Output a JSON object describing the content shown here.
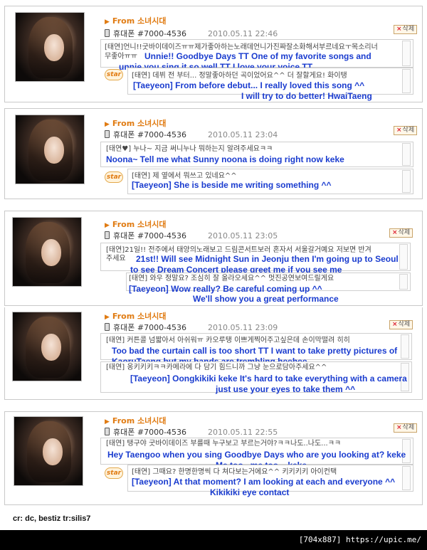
{
  "posts": [
    {
      "from": "From 소녀시대",
      "phone": "휴대폰 #7000-4536",
      "date": "2010.05.11 22:46",
      "delete": "삭제",
      "comment_kr": [
        "[태연]언니!!굿바이데이즈ㅠㅠ제가좋아하는노래데언니가진짜잘소화해서부르네요ㅜ목소리너",
        "무좋아ㅠㅠ"
      ],
      "comment_en": [
        "Unnie!! Goodbye Days TT One of my favorite songs and",
        "unnie you sing it so well TT I love your voice TT"
      ],
      "star": "star",
      "reply_kr": [
        "[태연] 데뷔 전 부터... 정말좋아하던 곡이었어요^^ 더 잘할게요! 화이탱"
      ],
      "reply_en": [
        "[Taeyeon] From before debut... I really loved this song ^^",
        "I will try to do better! HwaiTaeng"
      ]
    },
    {
      "from": "From 소녀시대",
      "phone": "휴대폰 #7000-4536",
      "date": "2010.05.11 23:04",
      "delete": "삭제",
      "comment_kr": [
        "[태연♥] 누나~ 지금 써니누나 뭐하는지 알려주세요ㅋㅋ"
      ],
      "comment_en": [
        "Noona~ Tell me what Sunny noona is doing right now keke"
      ],
      "star": "star",
      "reply_kr": [
        "[태연] 제 옆에서 뭐쓰고 있네요^^"
      ],
      "reply_en": [
        "[Taeyeon] She is beside me writing something ^^"
      ]
    },
    {
      "from": "From 소녀시대",
      "phone": "휴대폰 #7000-4536",
      "date": "2010.05.11 23:05",
      "delete": "삭제",
      "comment_kr": [
        "[태연]21일!! 전주에서 태양의노래보고 드림콘서트보러 혼자서 서울갈거예요 저보면 반겨",
        "주세요"
      ],
      "comment_en": [
        "21st!! Will see Midnight Sun in Jeonju then I'm going up to Seoul",
        "to see Dream Concert please greet me if you see me"
      ],
      "star": "star",
      "reply_kr": [
        "[태연] 와우 정말요? 조심히 잘 올라오세요^^ 멋진공연보여드릴게요"
      ],
      "reply_en": [
        "[Taeyeon] Wow really? Be careful coming up ^^",
        "We'll show you a great performance"
      ]
    },
    {
      "from": "From 소녀시대",
      "phone": "휴대폰 #7000-4536",
      "date": "2010.05.11 23:09",
      "delete": "삭제",
      "comment_kr": [
        "[태연] 커튼콜 넘짧아서 아쉬워ㅠ 카오루탱 이쁘게찍어주고싶은데 손이막떨려 히히"
      ],
      "comment_en": [
        "Too bad the curtain call is too short TT I want to take pretty pictures of",
        "KaoruTaeng but my hands are trembling heehee"
      ],
      "star": "star",
      "reply_kr": [
        "[태연] 옹키키키ㅋㅋ카메라에 다 담기 힘드니까 그냥 눈으로담아주세요^^"
      ],
      "reply_en": [
        "[Taeyeon] Oongkikiki keke It's hard to take everything with a camera",
        "just use your eyes to take them ^^"
      ]
    },
    {
      "from": "From 소녀시대",
      "phone": "휴대폰 #7000-4536",
      "date": "2010.05.11 22:55",
      "delete": "삭제",
      "comment_kr": [
        "[태연] 탱구야 굿바이데이즈 부를때 누구보고 부르는거야?ㅋㅋ나도..나도...ㅋㅋ"
      ],
      "comment_en": [
        "Hey Taengoo when you sing Goodbye Days who are you looking at? keke",
        "Me too.. me too... keke"
      ],
      "star": "star",
      "reply_kr": [
        "[태연] 그때요? 한명한명씩 다 쳐다보는거에요^^ 키키키키 아이컨택"
      ],
      "reply_en": [
        "[Taeyeon] At that moment? I am looking at each and everyone ^^",
        "Kikikiki eye contact"
      ]
    }
  ],
  "credit": "cr: dc, bestiz  tr:silis7",
  "footer": "[704x887] https://upic.me/"
}
